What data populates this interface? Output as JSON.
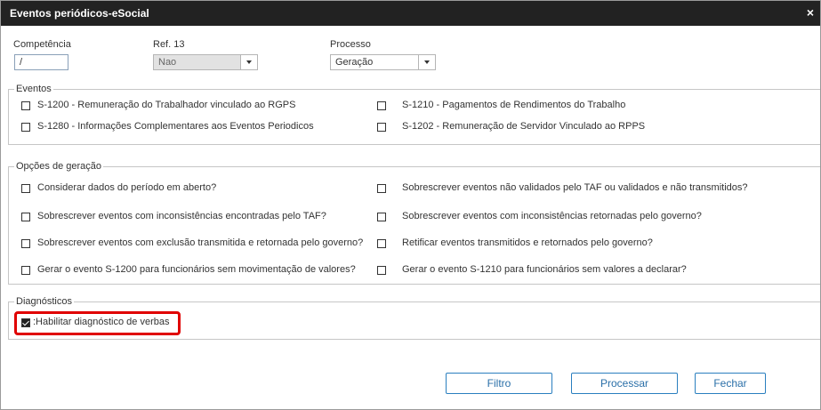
{
  "window": {
    "title": "Eventos periódicos-eSocial",
    "close_glyph": "×"
  },
  "header_fields": {
    "competencia": {
      "label": "Competência",
      "value": "/"
    },
    "ref13": {
      "label": "Ref. 13",
      "value": "Nao"
    },
    "processo": {
      "label": "Processo",
      "value": "Geração"
    }
  },
  "eventos": {
    "legend": "Eventos",
    "items": [
      {
        "label": "S-1200 - Remuneração do Trabalhador vinculado ao RGPS",
        "checked": false
      },
      {
        "label": "S-1210 - Pagamentos de Rendimentos do Trabalho",
        "checked": false
      },
      {
        "label": "S-1280 - Informações Complementares aos Eventos Periodicos",
        "checked": false
      },
      {
        "label": "S-1202 - Remuneração de Servidor Vinculado ao RPPS",
        "checked": false
      }
    ]
  },
  "opcoes": {
    "legend": "Opções de geração",
    "items": [
      {
        "label": "Considerar dados do período em aberto?",
        "checked": false
      },
      {
        "label": "Sobrescrever eventos não validados pelo TAF ou validados e não transmitidos?",
        "checked": false
      },
      {
        "label": "Sobrescrever eventos com inconsistências encontradas pelo TAF?",
        "checked": false
      },
      {
        "label": "Sobrescrever eventos com inconsistências retornadas pelo governo?",
        "checked": false
      },
      {
        "label": "Sobrescrever eventos com exclusão transmitida e retornada pelo governo?",
        "checked": false
      },
      {
        "label": "Retificar eventos transmitidos e retornados pelo governo?",
        "checked": false
      },
      {
        "label": "Gerar o evento S-1200 para funcionários sem movimentação de valores?",
        "checked": false
      },
      {
        "label": "Gerar o evento S-1210 para funcionários sem valores a declarar?",
        "checked": false
      }
    ]
  },
  "diagnosticos": {
    "legend": "Diagnósticos",
    "item": {
      "label": ":Habilitar diagnóstico de verbas",
      "checked": true
    },
    "highlight_color": "#e00000"
  },
  "buttons": {
    "filtro": "Filtro",
    "processar": "Processar",
    "fechar": "Fechar"
  },
  "colors": {
    "titlebar": "#222222",
    "button_border": "#2a7fbf"
  }
}
